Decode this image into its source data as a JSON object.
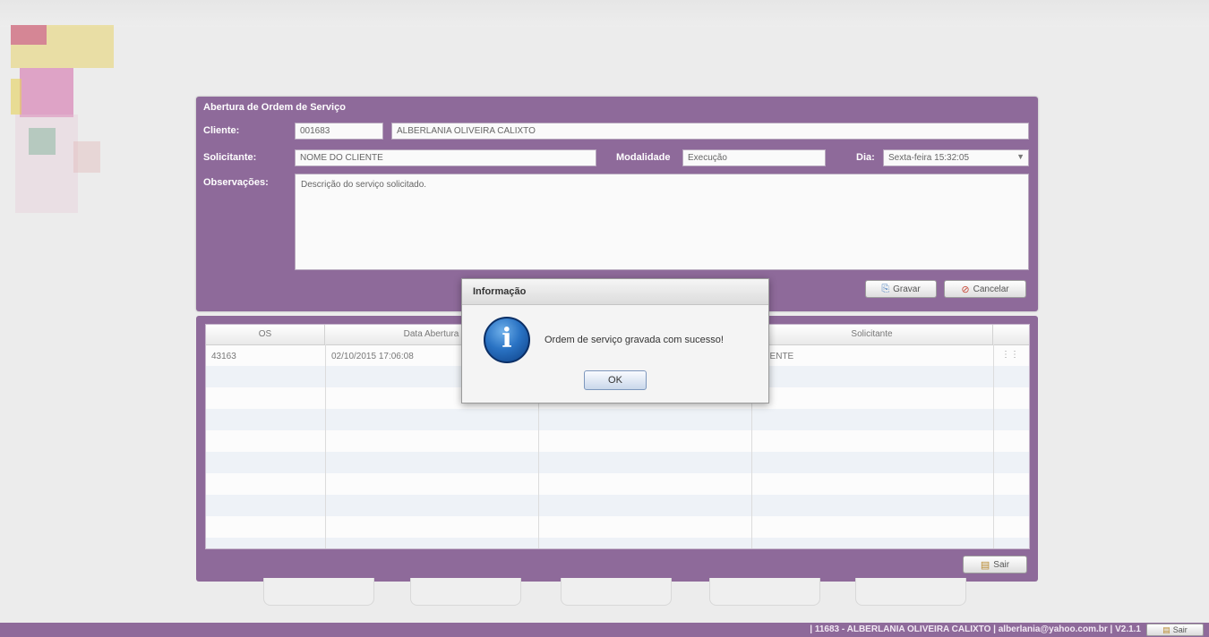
{
  "colors": {
    "panel": "#8e6a9a",
    "background": "#ececec"
  },
  "form": {
    "title": "Abertura de Ordem de Serviço",
    "cliente_label": "Cliente:",
    "cliente_code": "001683",
    "cliente_name": "ALBERLANIA OLIVEIRA CALIXTO",
    "solicitante_label": "Solicitante:",
    "solicitante_value": "NOME DO CLIENTE",
    "modalidade_label": "Modalidade",
    "modalidade_value": "Execução",
    "dia_label": "Dia:",
    "dia_value": "Sexta-feira 15:32:05",
    "observacoes_label": "Observações:",
    "observacoes_value": "Descrição do serviço solicitado.",
    "gravar_label": "Gravar",
    "cancelar_label": "Cancelar"
  },
  "grid": {
    "columns": [
      "OS",
      "Data Abertura",
      "",
      "Solicitante"
    ],
    "rows": [
      {
        "os": "43163",
        "data": "02/10/2015 17:06:08",
        "solicitante": "CLIENTE"
      }
    ],
    "sair_label": "Sair"
  },
  "modal": {
    "title": "Informação",
    "icon": "info-icon",
    "message": "Ordem de serviço gravada com sucesso!",
    "ok_label": "OK"
  },
  "footer": {
    "text": "| 11683 - ALBERLANIA OLIVEIRA CALIXTO | alberlania@yahoo.com.br | V2.1.1",
    "sair_label": "Sair"
  }
}
